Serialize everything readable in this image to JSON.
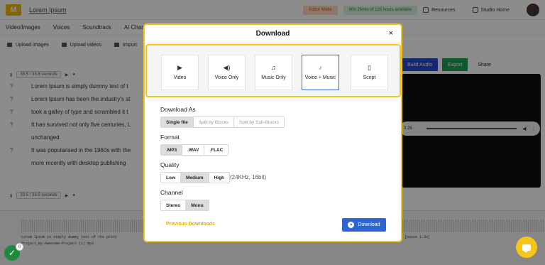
{
  "app": {
    "project_name": "Lorem Ipsum",
    "edit_mode": "Editor Mode",
    "hours": "60h 25min of 125 hours available",
    "resources": "Resources",
    "studio_home": "Studio Home",
    "menu": [
      "Video/Images",
      "Voices",
      "Soundtrack",
      "AI Chara"
    ],
    "toolbar": {
      "upload_images": "Upload images",
      "upload_videos": "Upload videos",
      "import": "Import"
    },
    "actions": {
      "build_audio": "Build Audio",
      "export": "Export",
      "share": "Share"
    },
    "player_time": "0:26",
    "segment1": {
      "badge": "33.5 / 33.8 seconds"
    },
    "segment2": {
      "badge": "33.5 / 33.5 seconds"
    },
    "lines": [
      "Lorem Ipsum is simply dummy text of t",
      "Lorem Ipsum has been the industry's st",
      "took a galley of type and scrambled it t",
      "It has survived not only five centuries, L",
      "unchanged.",
      "It was popularised in the 1960s with the",
      "more recently with desktop publishing"
    ],
    "timeline": {
      "row1": "Lorem Ipsum is simply dummy text of the print",
      "row1_right": "[pause 1.3s]",
      "row2": "Project_my-Awesome-Project (1).mp3"
    },
    "notification_count": "0"
  },
  "modal": {
    "title": "Download",
    "close": "×",
    "options": [
      {
        "label": "Video",
        "icon": "▶"
      },
      {
        "label": "Voice Only",
        "icon": "🔊"
      },
      {
        "label": "Music Only",
        "icon": "♫"
      },
      {
        "label": "Voice + Music",
        "icon": "🔔"
      },
      {
        "label": "Script",
        "icon": "📄"
      }
    ],
    "selected_option": "Voice + Music",
    "download_as": {
      "label": "Download As",
      "options": [
        "Single file",
        "Split by Blocks",
        "Split by Sub-Blocks"
      ],
      "selected": "Single file"
    },
    "format": {
      "label": "Format",
      "options": [
        ".MP3",
        ".WAV",
        ".FLAC"
      ],
      "selected": ".MP3"
    },
    "quality": {
      "label": "Quality",
      "options": [
        "Low",
        "Medium",
        "High"
      ],
      "selected": "Medium",
      "note": "(24KHz, 16bit)"
    },
    "channel": {
      "label": "Channel",
      "options": [
        "Stereo",
        "Mono"
      ],
      "selected": "Mono"
    },
    "previous_downloads": "Previous Downloads",
    "download_button": "Download"
  }
}
